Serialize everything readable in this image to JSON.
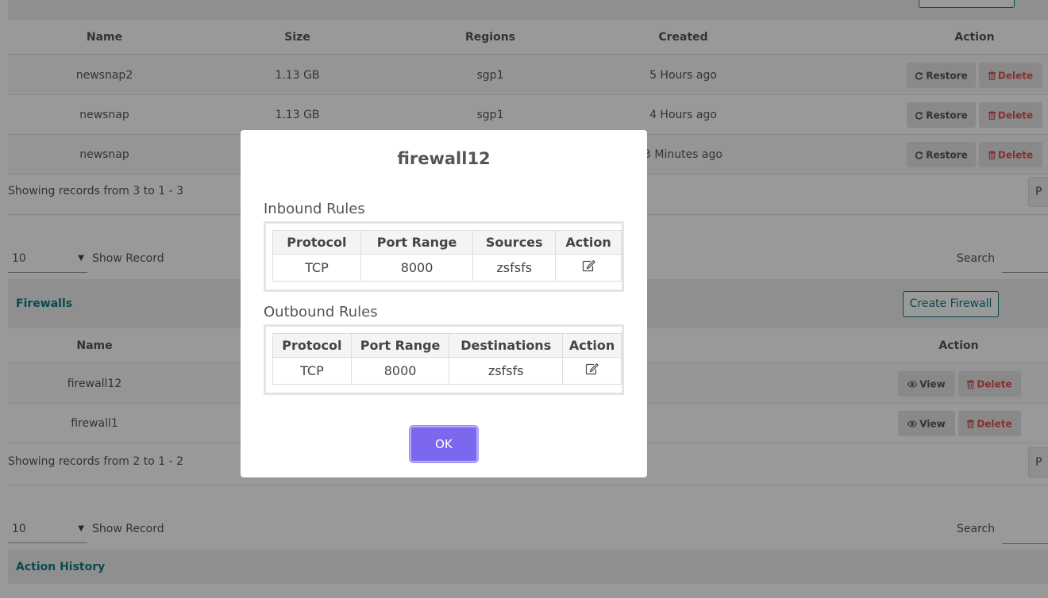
{
  "snapshots": {
    "create_button": "",
    "columns": [
      "Name",
      "Size",
      "Regions",
      "Created",
      "Action"
    ],
    "rows": [
      {
        "name": "newsnap2",
        "size": "1.13 GB",
        "region": "sgp1",
        "created": "5 Hours ago"
      },
      {
        "name": "newsnap",
        "size": "1.13 GB",
        "region": "sgp1",
        "created": "4 Hours ago"
      },
      {
        "name": "newsnap",
        "size": "",
        "region": "",
        "created": "3 Minutes ago"
      }
    ],
    "restore_label": "Restore",
    "delete_label": "Delete",
    "info": "Showing records from 3 to 1 - 3",
    "pager": "P"
  },
  "firewalls_controls": {
    "page_size": "10",
    "show_record": "Show Record",
    "search_label": "Search"
  },
  "firewalls": {
    "title": "Firewalls",
    "create_button": "Create Firewall",
    "columns": [
      "Name",
      "Action"
    ],
    "rows": [
      {
        "name": "firewall12"
      },
      {
        "name": "firewall1"
      }
    ],
    "view_label": "View",
    "delete_label": "Delete",
    "info": "Showing records from 2 to 1 - 2",
    "pager": "P"
  },
  "history_controls": {
    "page_size": "10",
    "show_record": "Show Record",
    "search_label": "Search"
  },
  "action_history": {
    "title": "Action History"
  },
  "modal": {
    "title": "firewall12",
    "inbound": {
      "label": "Inbound Rules",
      "columns": [
        "Protocol",
        "Port Range",
        "Sources",
        "Action"
      ],
      "rows": [
        {
          "protocol": "TCP",
          "port_range": "8000",
          "sources": "zsfsfs"
        }
      ]
    },
    "outbound": {
      "label": "Outbound Rules",
      "columns": [
        "Protocol",
        "Port Range",
        "Destinations",
        "Action"
      ],
      "rows": [
        {
          "protocol": "TCP",
          "port_range": "8000",
          "destinations": "zsfsfs"
        }
      ]
    },
    "ok_label": "OK"
  },
  "colors": {
    "accent": "#0c7e84",
    "danger": "#d9534f",
    "ok_button": "#7b68ee"
  }
}
